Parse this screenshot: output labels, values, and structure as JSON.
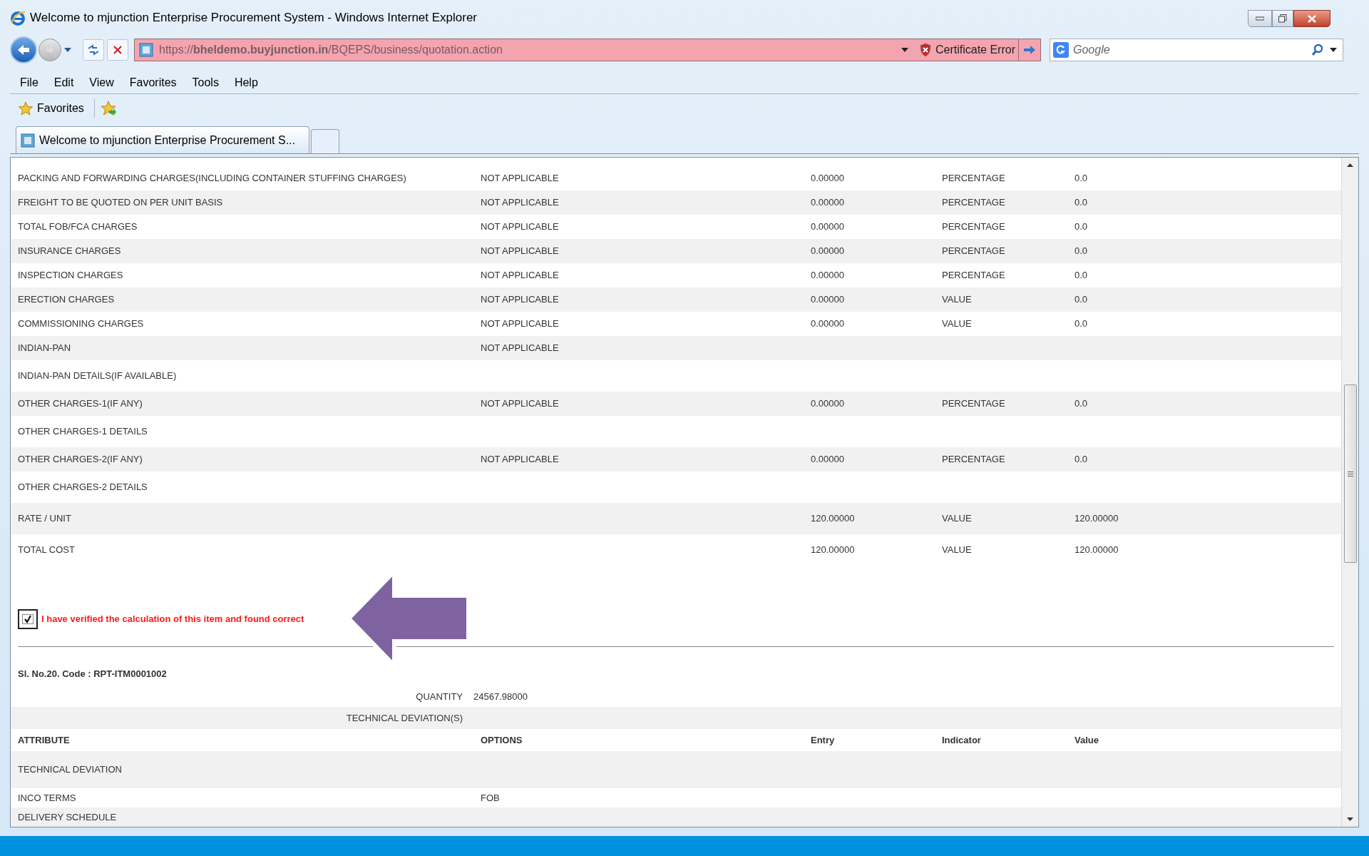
{
  "window": {
    "title": "Welcome to mjunction Enterprise Procurement System - Windows Internet Explorer"
  },
  "address_bar": {
    "url": "https://**bheldemo.buyjunction.in**/BQEPS/business/quotation.action",
    "certificate": "Certificate Error"
  },
  "search": {
    "placeholder": "Google"
  },
  "menu": [
    "File",
    "Edit",
    "View",
    "Favorites",
    "Tools",
    "Help"
  ],
  "favorites_bar": {
    "label": "Favorites"
  },
  "tabs": [
    {
      "title": "Welcome to mjunction Enterprise Procurement S...",
      "selected": true
    }
  ],
  "charges": {
    "rows": [
      {
        "attribute": "PACKING AND FORWARDING CHARGES(INCLUDING CONTAINER STUFFING CHARGES)",
        "option": "NOT APPLICABLE",
        "entry": "0.00000",
        "indicator": "PERCENTAGE",
        "value": "0.0"
      },
      {
        "attribute": "FREIGHT TO BE QUOTED ON PER UNIT BASIS",
        "option": "NOT APPLICABLE",
        "entry": "0.00000",
        "indicator": "PERCENTAGE",
        "value": "0.0"
      },
      {
        "attribute": "TOTAL FOB/FCA CHARGES",
        "option": "NOT APPLICABLE",
        "entry": "0.00000",
        "indicator": "PERCENTAGE",
        "value": "0.0"
      },
      {
        "attribute": "INSURANCE CHARGES",
        "option": "NOT APPLICABLE",
        "entry": "0.00000",
        "indicator": "PERCENTAGE",
        "value": "0.0"
      },
      {
        "attribute": "INSPECTION CHARGES",
        "option": "NOT APPLICABLE",
        "entry": "0.00000",
        "indicator": "PERCENTAGE",
        "value": "0.0"
      },
      {
        "attribute": "ERECTION CHARGES",
        "option": "NOT APPLICABLE",
        "entry": "0.00000",
        "indicator": "VALUE",
        "value": "0.0"
      },
      {
        "attribute": "COMMISSIONING CHARGES",
        "option": "NOT APPLICABLE",
        "entry": "0.00000",
        "indicator": "VALUE",
        "value": "0.0"
      },
      {
        "attribute": "INDIAN-PAN",
        "option": "NOT APPLICABLE"
      },
      {
        "attribute": "INDIAN-PAN DETAILS(IF AVAILABLE)"
      },
      {
        "attribute": "OTHER CHARGES-1(IF ANY)",
        "option": "NOT APPLICABLE",
        "entry": "0.00000",
        "indicator": "PERCENTAGE",
        "value": "0.0"
      },
      {
        "attribute": "OTHER CHARGES-1 DETAILS"
      },
      {
        "attribute": "OTHER CHARGES-2(IF ANY)",
        "option": "NOT APPLICABLE",
        "entry": "0.00000",
        "indicator": "PERCENTAGE",
        "value": "0.0"
      },
      {
        "attribute": "OTHER CHARGES-2 DETAILS"
      },
      {
        "attribute": "RATE / UNIT",
        "entry": "120.00000",
        "indicator": "VALUE",
        "value": "120.00000"
      },
      {
        "attribute": "TOTAL COST",
        "entry": "120.00000",
        "indicator": "VALUE",
        "value": "120.00000"
      }
    ]
  },
  "verification": {
    "checked": true,
    "label": "I have verified the calculation of this item and found correct"
  },
  "item": {
    "heading": "Sl. No.20. Code : RPT-ITM0001002",
    "quantity_label": "QUANTITY",
    "quantity": "24567.98000",
    "section": "TECHNICAL DEVIATION(S)",
    "columns": [
      "ATTRIBUTE",
      "OPTIONS",
      "Entry",
      "Indicator",
      "Value"
    ],
    "rows": [
      {
        "attribute": "TECHNICAL DEVIATION"
      },
      {
        "attribute": "INCO TERMS",
        "option": "FOB"
      },
      {
        "attribute": "DELIVERY SCHEDULE"
      }
    ]
  }
}
